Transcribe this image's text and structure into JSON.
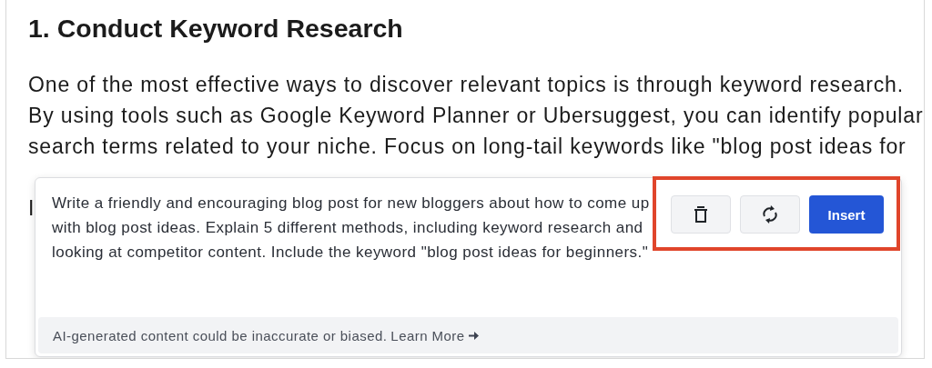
{
  "article": {
    "heading": "1. Conduct Keyword Research",
    "lines": [
      "One of the most effective ways to discover relevant topics is through keyword research.",
      "By using tools such as Google Keyword Planner or Ubersuggest, you can identify popular",
      "search terms related to your niche. Focus on long-tail keywords like \"blog post ideas for"
    ],
    "covered_line_start": "I"
  },
  "prompt_popup": {
    "prompt": "Write a friendly and encouraging blog post for new bloggers about how to come up with blog post ideas. Explain 5 different methods, including keyword research and looking at competitor content. Include the keyword \"blog post ideas for beginners.\"",
    "insert_button": "Insert",
    "disclaimer": "AI-generated content could be inaccurate or biased.",
    "learn_more": "Learn More"
  }
}
